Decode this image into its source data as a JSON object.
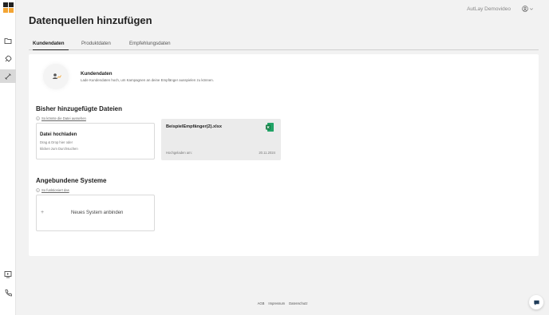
{
  "header": {
    "user_name": "AutLay Demovideo",
    "page_title": "Datenquellen hinzufügen"
  },
  "sidebar": {
    "items": [
      {
        "icon": "folder-icon"
      },
      {
        "icon": "rocket-icon"
      },
      {
        "icon": "link-icon",
        "active": true
      },
      {
        "icon": "video-icon"
      },
      {
        "icon": "phone-icon"
      }
    ]
  },
  "tabs": [
    {
      "label": "Kundendaten",
      "active": true
    },
    {
      "label": "Produktdaten",
      "active": false
    },
    {
      "label": "Empfehlungsdaten",
      "active": false
    }
  ],
  "hero": {
    "title": "Kundendaten",
    "description": "Lade Kundendaten hoch, um Kampagnen an deine Empfänger ausspielen zu können."
  },
  "files_section": {
    "title": "Bisher hinzugefügte Dateien",
    "hint": "So könnte die Datei aussehen",
    "upload": {
      "title": "Datei hochladen",
      "line1": "Drag & Drop hier oder",
      "line2": "klicken zum Durchsuchen"
    },
    "file": {
      "name": "BeispielEmpfänger(2).xlsx",
      "uploaded_label": "Hochgeladen am:",
      "uploaded_date": "20.11.2024"
    }
  },
  "systems_section": {
    "title": "Angebundene Systeme",
    "hint": "So funktioniert das",
    "new_system": "Neues System anbinden"
  },
  "footer": {
    "links": [
      "AGB",
      "Impressum",
      "Datenschutz"
    ]
  },
  "colors": {
    "background": "#f2f2f2",
    "card": "#ffffff",
    "file_card": "#ebebeb",
    "excel_green": "#1e7145",
    "logo_orange": "#f3a534",
    "logo_dark": "#222222"
  }
}
